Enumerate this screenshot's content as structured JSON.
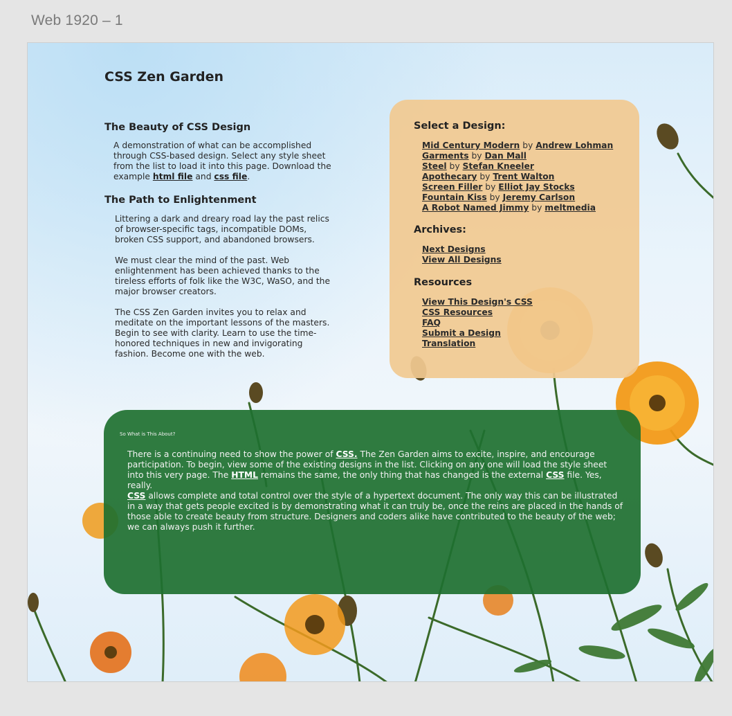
{
  "frame": {
    "label": "Web 1920 – 1"
  },
  "header": {
    "title": "CSS Zen Garden"
  },
  "intro": {
    "heading": "The Beauty of CSS Design",
    "text_1": "A demonstration of what can be accomplished through CSS-based design. Select any style sheet from the list to load it into this page. Download the example ",
    "html_link": "html file",
    "and": " and ",
    "css_link": "css file",
    "end": "."
  },
  "path": {
    "heading": "The Path to Enlightenment",
    "para_1": "Littering a dark and dreary road lay the past relics of browser-specific tags, incompatible DOMs, broken CSS support, and abandoned browsers.",
    "para_2": "We must clear the mind of the past. Web enlightenment has been achieved thanks to the tireless efforts of folk like the W3C, WaSO, and the major browser creators.",
    "para_3": "The CSS Zen Garden invites you to relax and meditate on the important lessons of the masters. Begin to see with clarity. Learn to use the time-honored techniques in new and invigorating fashion. Become one with the web."
  },
  "sidebar": {
    "select_heading": "Select a Design:",
    "by": "by",
    "designs": [
      {
        "name": "Mid Century Modern",
        "author": "Andrew Lohman"
      },
      {
        "name": "Garments",
        "author": "Dan Mall"
      },
      {
        "name": "Steel",
        "author": "Stefan Kneeler"
      },
      {
        "name": "Apothecary",
        "author": "Trent Walton"
      },
      {
        "name": "Screen Filler",
        "author": "Elliot Jay Stocks"
      },
      {
        "name": "Fountain Kiss",
        "author": "Jeremy Carlson"
      },
      {
        "name": "A Robot Named Jimmy",
        "author": "meltmedia"
      }
    ],
    "archives_heading": "Archives:",
    "archives": [
      "Next Designs",
      "View All Designs"
    ],
    "resources_heading": "Resources",
    "resources": [
      "View This Design's CSS",
      "CSS Resources",
      "FAQ",
      "Submit a Design",
      "Translation"
    ]
  },
  "explanation": {
    "heading": "So What is This About?",
    "p1_a": "There is a continuing need to show the power of ",
    "p1_css": "CSS.",
    "p1_b": " The Zen Garden aims to excite, inspire, and encourage participation. To begin, view some of the existing designs in the list. Clicking on any one will load the style sheet into this very page. The ",
    "p1_html": "HTML",
    "p1_c": " remains the same, the only thing that has changed is the external ",
    "p1_css2": "CSS",
    "p1_d": " file. Yes, really.",
    "p2_css": "CSS",
    "p2_a": " allows complete and total control over the style of a hypertext document. The only way this can be illustrated in a way that gets people excited is by demonstrating what it can truly be, once the reins are placed in the hands of those able to create beauty from structure. Designers and coders alike have contributed to the beauty of the web; we can always push it further."
  },
  "colors": {
    "sidebar_bg": "#f1c991",
    "explanation_bg": "#1e7030",
    "flower": "#f5a623",
    "sky": "#dfeef9"
  }
}
